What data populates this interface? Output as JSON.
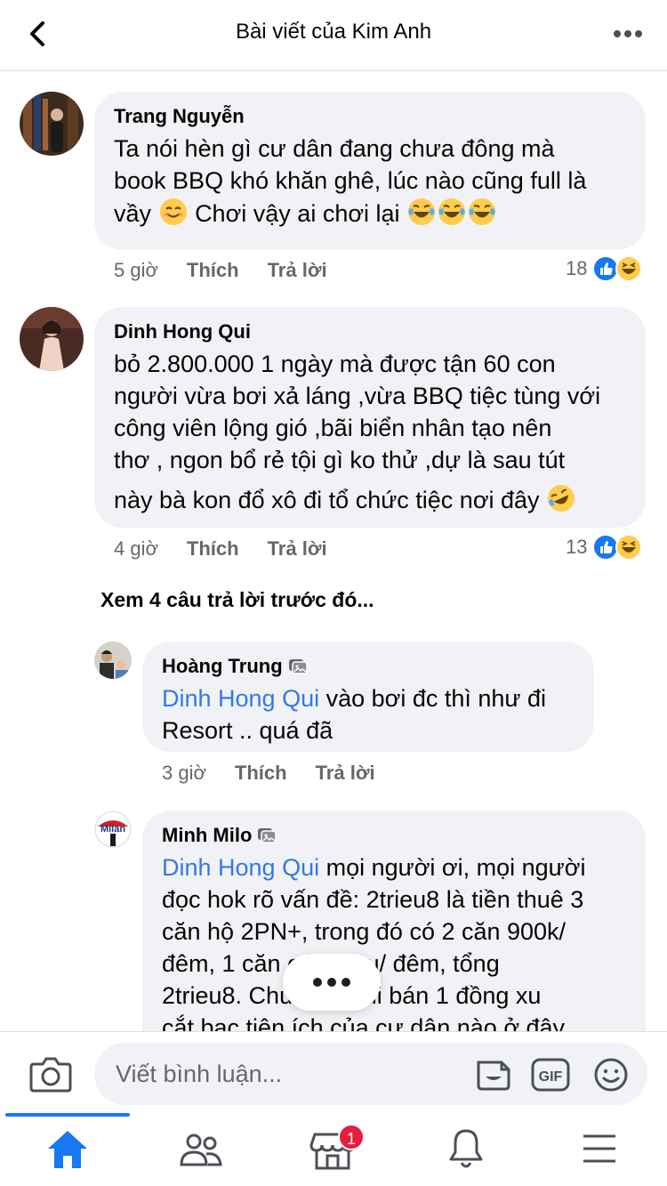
{
  "header": {
    "title": "Bài viết của Kim Anh"
  },
  "comments": [
    {
      "author": "Trang Nguyễn",
      "text_line1": "Ta nói hèn gì cư dân đang chưa đông mà",
      "text_line2": "book BBQ khó khăn ghê, lúc nào cũng full là",
      "text_line3a": "vầy",
      "text_line3b": "Chơi vậy ai chơi lại",
      "time": "5 giờ",
      "like_label": "Thích",
      "reply_label": "Trả lời",
      "reaction_count": "18"
    },
    {
      "author": "Dinh Hong Qui",
      "text_line1": "bỏ 2.800.000 1 ngày mà được tận 60 con",
      "text_line2": "người vừa bơi xả láng ,vừa BBQ tiệc tùng với",
      "text_line3": "công viên lộng gió ,bãi biển nhân tạo nên",
      "text_line4": "thơ , ngon bổ rẻ tội gì ko thử ,dự là sau tút",
      "text_line5": "này bà kon đổ xô đi tổ chức tiệc nơi đây",
      "time": "4 giờ",
      "like_label": "Thích",
      "reply_label": "Trả lời",
      "reaction_count": "13"
    }
  ],
  "view_previous_replies": "Xem 4 câu trả lời trước đó...",
  "replies": [
    {
      "author": "Hoàng Trung",
      "mention": "Dinh Hong Qui",
      "text_line1": " vào bơi đc thì như đi",
      "text_line2": "Resort .. quá đã",
      "time": "3 giờ",
      "like_label": "Thích",
      "reply_label": "Trả lời"
    },
    {
      "author": "Minh Milo",
      "mention": "Dinh Hong Qui",
      "text_line1": " mọi người ơi, mọi người",
      "text_line2": "đọc hok rõ vấn đề: 2trieu8 là tiền thuê 3",
      "text_line3": "căn hộ 2PN+, trong đó có 2 căn 900k/",
      "text_line4": "đêm, 1 căn có 1trieu/ đêm, tổng",
      "text_line5": "2trieu8. Chứ chưa đi bán 1 đồng xu",
      "text_line6": "cắt bạc tiện ích của cư dân nào ở đây"
    }
  ],
  "composer": {
    "placeholder": "Viết bình luận..."
  },
  "tabbar": {
    "notification_count": "1"
  },
  "colors": {
    "accent": "#1877f2",
    "mention": "#3578e5",
    "bubble": "#f0f2f5",
    "meta": "#65676b"
  }
}
